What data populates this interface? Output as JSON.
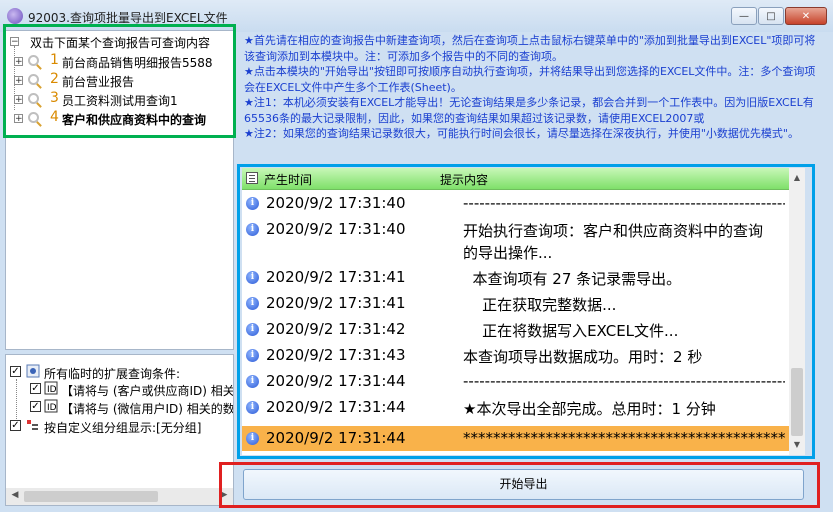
{
  "window": {
    "title": "92003.查询项批量导出到EXCEL文件",
    "minimize_glyph": "—",
    "maximize_glyph": "□",
    "close_glyph": "✕"
  },
  "left_tree": {
    "root_label": "双击下面某个查询报告可查询内容",
    "items": [
      {
        "num": "1",
        "label": "前台商品销售明细报告5588",
        "bold": false
      },
      {
        "num": "2",
        "label": "前台营业报告",
        "bold": false
      },
      {
        "num": "3",
        "label": "员工资料测试用查询1",
        "bold": false
      },
      {
        "num": "4",
        "label": "客户和供应商资料中的查询",
        "bold": true
      }
    ]
  },
  "conditions": {
    "root_label": "所有临时的扩展查询条件:",
    "items": [
      "【请将与 (客户或供应商ID) 相关的",
      "【请将与 (微信用户ID) 相关的数"
    ],
    "group_label": "按自定义组分组显示:[无分组]"
  },
  "instructions": [
    "★首先请在相应的查询报告中新建查询项，然后在查询项上点击鼠标右键菜单中的\"添加到批量导出到EXCEL\"项即可将该查询添加到本模块中。注：可添加多个报告中的不同的查询项。",
    "★点击本模块的\"开始导出\"按钮即可按顺序自动执行查询项，并将结果导出到您选择的EXCEL文件中。注：多个查询项会在EXCEL文件中产生多个工作表(Sheet)。",
    "★注1：本机必须安装有EXCEL才能导出！无论查询结果是多少条记录，都会合并到一个工作表中。因为旧版EXCEL有65536条的最大记录限制，因此，如果您的查询结果如果超过该记录数，请使用EXCEL2007或",
    "★注2：如果您的查询结果记录数很大，可能执行时间会很长，请尽量选择在深夜执行，并使用\"小数据优先模式\"。"
  ],
  "log": {
    "col_time": "产生时间",
    "col_msg": "提示内容",
    "rows": [
      {
        "time": "2020/9/2 17:31:40",
        "msg": "----------------------------------------------------------------",
        "selected": false
      },
      {
        "time": "2020/9/2 17:31:40",
        "msg": "开始执行查询项：客户和供应商资料中的查询",
        "msg2": "的导出操作...",
        "selected": false
      },
      {
        "time": "2020/9/2 17:31:41",
        "msg": "  本查询项有 27 条记录需导出。",
        "selected": false
      },
      {
        "time": "2020/9/2 17:31:41",
        "msg": "    正在获取完整数据...",
        "selected": false
      },
      {
        "time": "2020/9/2 17:31:42",
        "msg": "    正在将数据写入EXCEL文件...",
        "selected": false
      },
      {
        "time": "2020/9/2 17:31:43",
        "msg": "本查询项导出数据成功。用时：2 秒",
        "selected": false
      },
      {
        "time": "2020/9/2 17:31:44",
        "msg": "----------------------------------------------------------------",
        "selected": false
      },
      {
        "time": "2020/9/2 17:31:44",
        "msg": "★本次导出全部完成。总用时：1 分钟",
        "selected": false
      },
      {
        "time": "2020/9/2 17:31:44",
        "msg": "****************************************************************",
        "selected": true
      }
    ]
  },
  "start_button": "开始导出",
  "colors": {
    "highlight_green": "#00b050",
    "highlight_blue": "#00a0e9",
    "highlight_red": "#e02020",
    "selected_row": "#f9b24a",
    "instruction_text": "#1a3fd0"
  }
}
